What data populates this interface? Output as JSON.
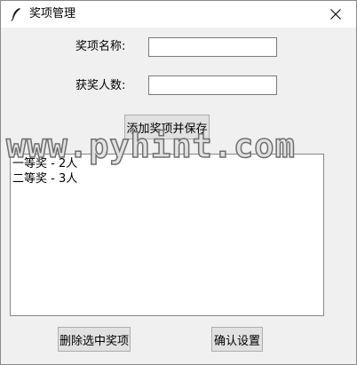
{
  "window": {
    "title": "奖项管理",
    "close_symbol": "✕"
  },
  "form": {
    "name_label": "奖项名称:",
    "name_value": "",
    "count_label": "获奖人数:",
    "count_value": ""
  },
  "buttons": {
    "add_save": "添加奖项并保存",
    "delete_selected": "删除选中奖项",
    "confirm": "确认设置"
  },
  "awards_list": [
    "一等奖 - 2人",
    "二等奖 - 3人"
  ],
  "watermark": "www.pyhint.com",
  "icons": {
    "app": "feather-icon",
    "close": "close-icon"
  }
}
